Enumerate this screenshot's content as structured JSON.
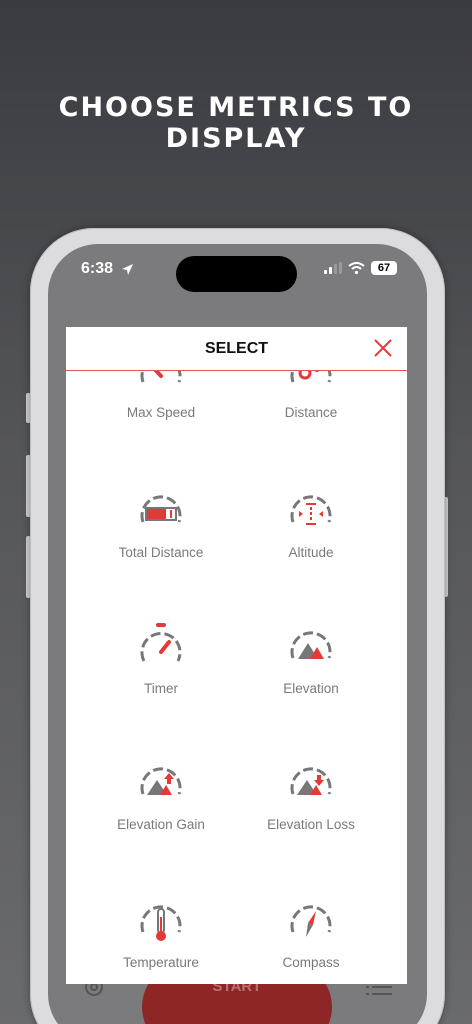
{
  "headline": "CHOOSE METRICS TO DISPLAY",
  "status": {
    "time": "6:38",
    "battery": "67"
  },
  "modal": {
    "title": "SELECT",
    "metrics": [
      {
        "label": "Max Speed",
        "icon": "speedometer-icon"
      },
      {
        "label": "Distance",
        "icon": "map-pin-icon"
      },
      {
        "label": "Total Distance",
        "icon": "odometer-icon"
      },
      {
        "label": "Altitude",
        "icon": "altitude-icon"
      },
      {
        "label": "Timer",
        "icon": "stopwatch-icon"
      },
      {
        "label": "Elevation",
        "icon": "mountain-icon"
      },
      {
        "label": "Elevation Gain",
        "icon": "mountain-up-icon"
      },
      {
        "label": "Elevation Loss",
        "icon": "mountain-down-icon"
      },
      {
        "label": "Temperature",
        "icon": "thermometer-icon"
      },
      {
        "label": "Compass",
        "icon": "compass-icon"
      }
    ]
  },
  "bottom_bar": {
    "start_label": "START"
  },
  "colors": {
    "accent": "#e53935",
    "gray": "#7a7a7a"
  }
}
